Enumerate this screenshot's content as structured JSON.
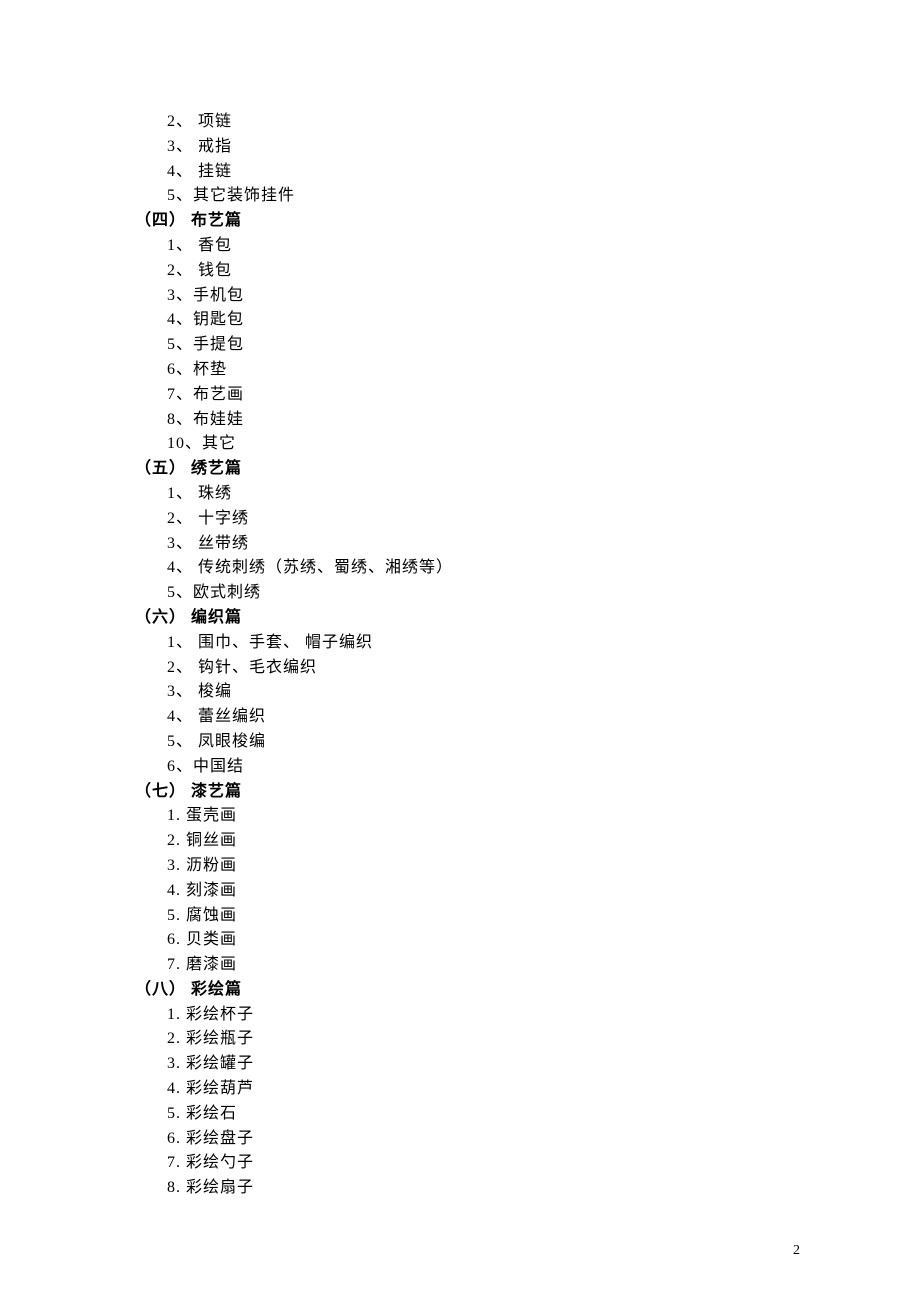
{
  "preItems": [
    "2、 项链",
    "3、 戒指",
    "4、 挂链",
    "5、其它装饰挂件"
  ],
  "sections": [
    {
      "heading": "（四）  布艺篇",
      "items": [
        "1、 香包",
        "2、 钱包",
        "3、手机包",
        "4、钥匙包",
        "5、手提包",
        "6、杯垫",
        "7、布艺画",
        "8、布娃娃",
        "10、其它"
      ]
    },
    {
      "heading": "（五）  绣艺篇",
      "items": [
        "1、 珠绣",
        "2、 十字绣",
        "3、 丝带绣",
        "4、 传统刺绣（苏绣、蜀绣、湘绣等）",
        "5、欧式刺绣"
      ]
    },
    {
      "heading": "（六）  编织篇",
      "items": [
        "1、 围巾、手套、  帽子编织",
        "2、 钩针、毛衣编织",
        "3、 梭编",
        "4、 蕾丝编织",
        "5、 凤眼梭编",
        "6、中国结"
      ]
    },
    {
      "heading": "（七）  漆艺篇",
      "items": [
        "1.    蛋壳画",
        "2.    铜丝画",
        "3.    沥粉画",
        "4.    刻漆画",
        "5.    腐蚀画",
        "6.    贝类画",
        "7.    磨漆画"
      ]
    },
    {
      "heading": "（八）  彩绘篇",
      "items": [
        "1.    彩绘杯子",
        "2.    彩绘瓶子",
        "3.    彩绘罐子",
        "4.    彩绘葫芦",
        "5.    彩绘石",
        "6.    彩绘盘子",
        "7.    彩绘勺子",
        "8.    彩绘扇子"
      ]
    }
  ],
  "pageNumber": "2"
}
